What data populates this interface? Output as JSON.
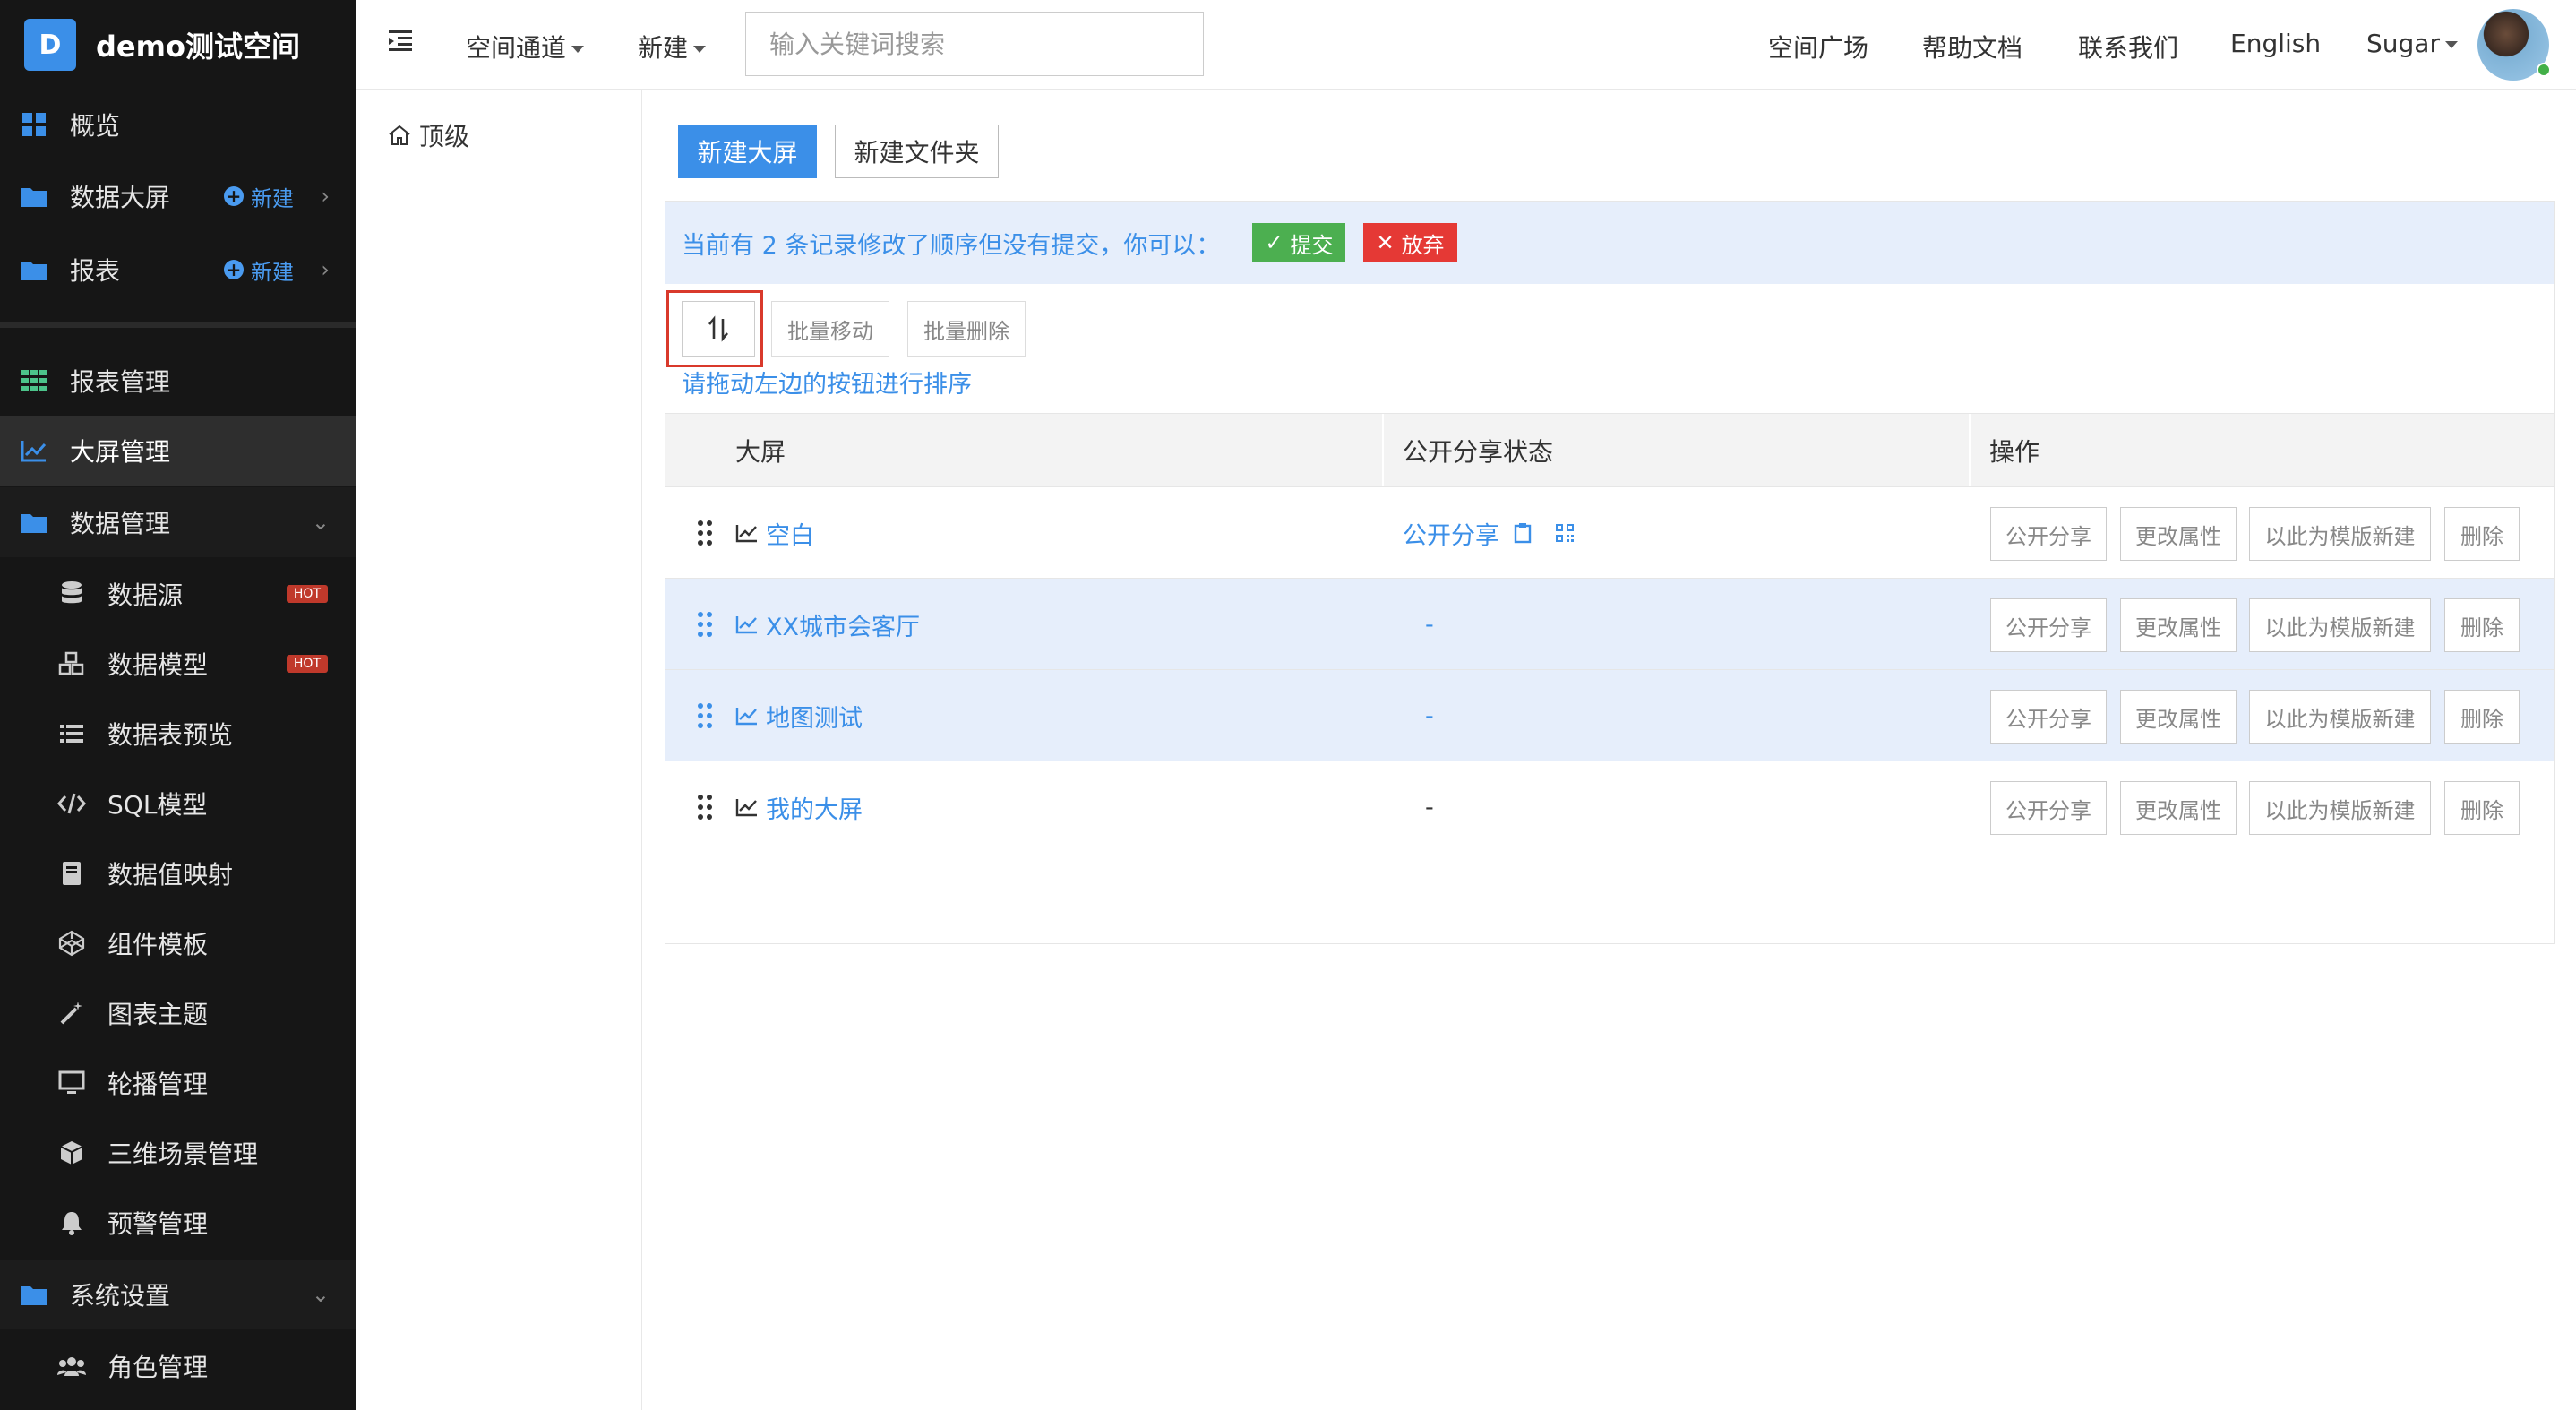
{
  "brand": {
    "logo_letter": "D",
    "title": "demo测试空间",
    "logo_color": "#3b8fe8"
  },
  "sidebar": {
    "items": [
      {
        "label": "概览",
        "icon": "grid-icon"
      },
      {
        "label": "数据大屏",
        "icon": "folder-icon",
        "new_label": "新建"
      },
      {
        "label": "报表",
        "icon": "folder-icon",
        "new_label": "新建"
      },
      {
        "label": "报表管理",
        "icon": "table-grid-icon"
      },
      {
        "label": "大屏管理",
        "icon": "line-chart-icon",
        "active": true
      },
      {
        "label": "数据管理",
        "icon": "folder-icon"
      },
      {
        "label": "数据源",
        "icon": "database-icon",
        "badge": "HOT"
      },
      {
        "label": "数据模型",
        "icon": "cubes-icon",
        "badge": "HOT"
      },
      {
        "label": "数据表预览",
        "icon": "list-icon"
      },
      {
        "label": "SQL模型",
        "icon": "code-icon"
      },
      {
        "label": "数据值映射",
        "icon": "book-icon"
      },
      {
        "label": "组件模板",
        "icon": "codepen-icon"
      },
      {
        "label": "图表主题",
        "icon": "magic-wand-icon"
      },
      {
        "label": "轮播管理",
        "icon": "monitor-icon"
      },
      {
        "label": "三维场景管理",
        "icon": "cube-icon"
      },
      {
        "label": "预警管理",
        "icon": "bell-icon"
      },
      {
        "label": "系统设置",
        "icon": "folder-icon"
      },
      {
        "label": "角色管理",
        "icon": "users-icon"
      }
    ]
  },
  "topbar": {
    "space_channel": "空间通道",
    "new": "新建",
    "search_placeholder": "输入关键词搜索",
    "space_square": "空间广场",
    "help_docs": "帮助文档",
    "contact_us": "联系我们",
    "language": "English",
    "user": "Sugar"
  },
  "tree": {
    "root": "顶级"
  },
  "main": {
    "new_screen": "新建大屏",
    "new_folder": "新建文件夹",
    "notice": "当前有 2 条记录修改了顺序但没有提交，你可以：",
    "submit": "提交",
    "discard": "放弃",
    "batch_move": "批量移动",
    "batch_delete": "批量删除",
    "drag_hint": "请拖动左边的按钮进行排序",
    "columns": [
      "大屏",
      "公开分享状态",
      "操作"
    ],
    "actions": [
      "公开分享",
      "更改属性",
      "以此为模版新建",
      "删除"
    ],
    "rows": [
      {
        "name": "空白",
        "share": "公开分享",
        "highlighted": false
      },
      {
        "name": "XX城市会客厅",
        "share": "-",
        "highlighted": true
      },
      {
        "name": "地图测试",
        "share": "-",
        "highlighted": true
      },
      {
        "name": "我的大屏",
        "share": "-",
        "highlighted": false
      }
    ]
  },
  "colors": {
    "accent": "#3b8fe8",
    "sidebar_bg": "#161616",
    "submit": "#4caf50",
    "discard": "#e53935",
    "highlight_box": "#d9392b"
  }
}
